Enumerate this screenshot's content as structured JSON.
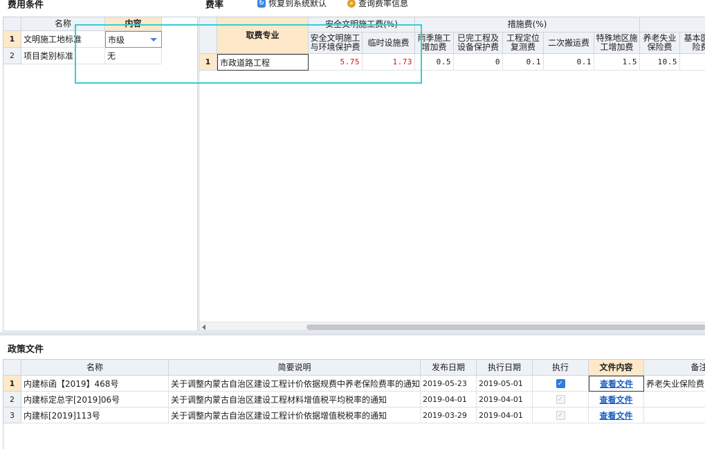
{
  "fee_conditions": {
    "title": "费用条件",
    "col_name": "名称",
    "col_content": "内容",
    "rows": [
      {
        "num": "1",
        "name": "文明施工地标准",
        "value": "市级"
      },
      {
        "num": "2",
        "name": "项目类别标准",
        "value": "无"
      }
    ]
  },
  "rates": {
    "title": "费率",
    "restore_label": "恢复到系统默认",
    "query_label": "查询费率信息",
    "col_major": "取费专业",
    "group_safety": "安全文明施工费(%)",
    "group_measure": "措施费(%)",
    "cols": [
      "安全文明施工与环境保护费",
      "临时设施费",
      "雨季施工增加费",
      "已完工程及设备保护费",
      "工程定位复测费",
      "二次搬运费",
      "特殊地区施工增加费",
      "养老失业保险费",
      "基本医保险费"
    ],
    "row": {
      "num": "1",
      "major": "市政道路工程",
      "values": [
        "5.75",
        "1.73",
        "0.5",
        "0",
        "0.1",
        "0.1",
        "1.5",
        "10.5",
        ""
      ]
    }
  },
  "policy": {
    "title": "政策文件",
    "headers": {
      "name": "名称",
      "desc": "简要说明",
      "pub": "发布日期",
      "exec_date": "执行日期",
      "exec": "执行",
      "content": "文件内容",
      "note": "备注"
    },
    "rows": [
      {
        "num": "1",
        "name": "内建标函【2019】468号",
        "desc": "关于调整内蒙古自治区建设工程计价依据规费中养老保险费率的通知",
        "pub": "2019-05-23",
        "exec_date": "2019-05-01",
        "checked": true,
        "link": "查看文件",
        "note": "养老失业保险费"
      },
      {
        "num": "2",
        "name": "内建标定总字[2019]06号",
        "desc": "关于调整内蒙古自治区建设工程材料增值税平均税率的通知",
        "pub": "2019-04-01",
        "exec_date": "2019-04-01",
        "checked": true,
        "link": "查看文件",
        "note": ""
      },
      {
        "num": "3",
        "name": "内建标[2019]113号",
        "desc": "关于调整内蒙古自治区建设工程计价依据增值税税率的通知",
        "pub": "2019-03-29",
        "exec_date": "2019-04-01",
        "checked": true,
        "link": "查看文件",
        "note": ""
      }
    ]
  },
  "colors": {
    "highlight": "#fde9c9",
    "selection_box": "#2fd0d0",
    "link": "#1a5fc0",
    "red_value": "#dd1111"
  }
}
